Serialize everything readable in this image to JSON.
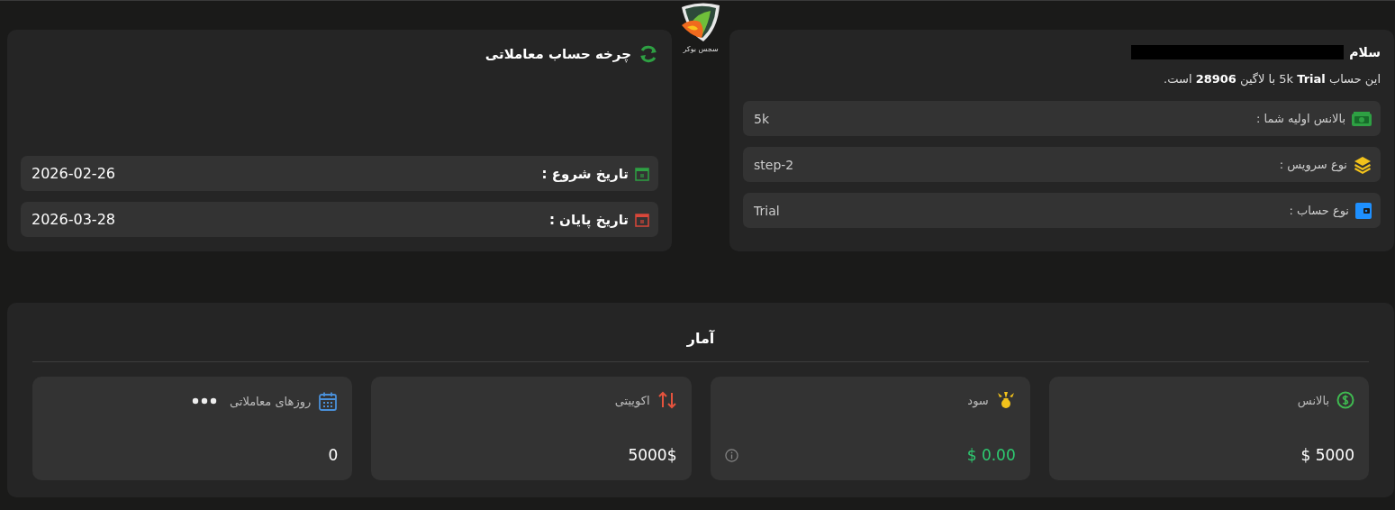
{
  "logo": {
    "caption": "سجس بوکر"
  },
  "account_card": {
    "greeting": "سلام",
    "name_redacted": true,
    "summary": "این حساب 5k **Trial** با لاگین **28906** است.",
    "rows": [
      {
        "kind": "money",
        "label": "بالانس اولیه شما :",
        "value": "5k"
      },
      {
        "kind": "layers",
        "label": "نوع سرویس :",
        "value": "step-2"
      },
      {
        "kind": "wallet",
        "label": "نوع حساب :",
        "value": "Trial"
      }
    ]
  },
  "cycle_card": {
    "title": "چرخه حساب معاملاتی",
    "rows": [
      {
        "kind": "start",
        "label": "تاریخ شروع :",
        "value": "2026-02-26"
      },
      {
        "kind": "end",
        "label": "تاریخ پایان :",
        "value": "2026-03-28"
      }
    ]
  },
  "stats": {
    "title": "آمار",
    "cards": [
      {
        "kind": "balance",
        "label": "بالانس",
        "value": "$ 5000",
        "color": "#ffffff"
      },
      {
        "kind": "profit",
        "label": "سود",
        "value": "$ 0.00",
        "color": "#2ecc71",
        "info": true
      },
      {
        "kind": "equity",
        "label": "اکوییتی",
        "value": "5000$",
        "color": "#ffffff"
      },
      {
        "kind": "days",
        "label": "روزهای معاملاتی",
        "value": "0",
        "color": "#ffffff",
        "menu": true
      }
    ]
  }
}
